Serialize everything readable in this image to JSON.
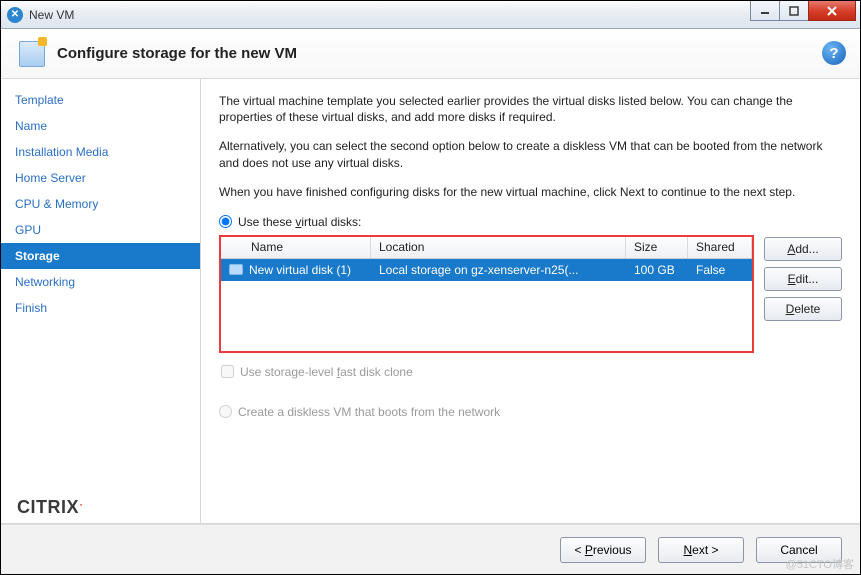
{
  "window": {
    "title": "New VM"
  },
  "header": {
    "title": "Configure storage for the new VM"
  },
  "sidebar": {
    "items": [
      {
        "label": "Template"
      },
      {
        "label": "Name"
      },
      {
        "label": "Installation Media"
      },
      {
        "label": "Home Server"
      },
      {
        "label": "CPU & Memory"
      },
      {
        "label": "GPU"
      },
      {
        "label": "Storage",
        "active": true
      },
      {
        "label": "Networking"
      },
      {
        "label": "Finish"
      }
    ]
  },
  "body": {
    "para1": "The virtual machine template you selected earlier provides the virtual disks listed below. You can change the properties of these virtual disks, and add more disks if required.",
    "para2": "Alternatively, you can select the second option below to create a diskless VM that can be booted from the network and does not use any virtual disks.",
    "para3": "When you have finished configuring disks for the new virtual machine, click Next to continue to the next step.",
    "radio_use": "Use these virtual disks:",
    "radio_diskless": "Create a diskless VM that boots from the network",
    "fast_clone": "Use storage-level fast disk clone",
    "columns": {
      "name": "Name",
      "location": "Location",
      "size": "Size",
      "shared": "Shared"
    },
    "rows": [
      {
        "name": "New virtual disk (1)",
        "location": "Local storage on gz-xenserver-n25(...",
        "size": "100 GB",
        "shared": "False"
      }
    ],
    "buttons": {
      "add": "Add...",
      "edit": "Edit...",
      "delete": "Delete"
    }
  },
  "footer": {
    "previous": "< Previous",
    "next": "Next >",
    "cancel": "Cancel"
  },
  "brand": "CITRIX",
  "watermark": "@51CTO博客"
}
